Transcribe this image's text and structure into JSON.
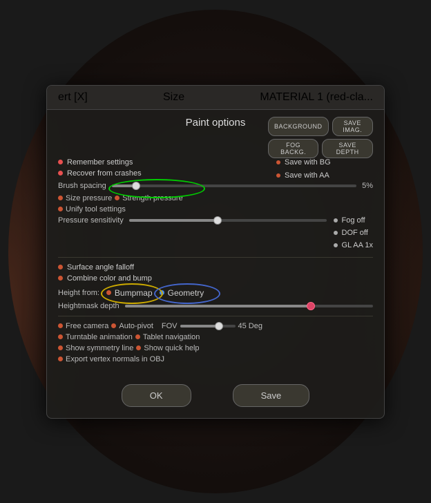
{
  "window": {
    "title_left": "ert [X]",
    "title_center": "Size",
    "title_right": "MATERIAL 1 (red-cla..."
  },
  "dialog": {
    "title": "Paint options",
    "buttons": {
      "background": "BACKGROUND",
      "save_image": "SAVE IMAG.",
      "fog_background": "FOG BACKG.",
      "save_depth": "SAVE DEPTH",
      "save_with_bg": "Save with BG",
      "save_with_aa": "Save with AA"
    },
    "options": {
      "remember_settings": "Remember settings",
      "recover_from_crashes": "Recover from crashes"
    },
    "brush_spacing": {
      "label": "Brush spacing",
      "value": "5%"
    },
    "checkboxes": {
      "size_pressure": "Size pressure",
      "strength_pressure": "Strength pressure",
      "unify_tool_settings": "Unify tool settings"
    },
    "pressure_sensitivity": "Pressure sensitivity",
    "right_options": {
      "fog_off": "Fog off",
      "dof_off": "DOF off",
      "gl_aa": "GL AA 1x"
    },
    "surface_options": {
      "surface_angle_falloff": "Surface angle falloff",
      "combine_color_and_bump": "Combine color and bump"
    },
    "height_from": {
      "label": "Height from:",
      "bumpmap": "Bumpmap",
      "geometry": "Geometry"
    },
    "heightmask_depth": "Heightmask depth",
    "bottom_options": {
      "free_camera": "Free camera",
      "auto_pivot": "Auto-pivot",
      "fov_label": "FOV",
      "fov_value": "45 Deg",
      "turntable_animation": "Turntable animation",
      "tablet_navigation": "Tablet navigation",
      "show_symmetry_line": "Show symmetry line",
      "show_quick_help": "Show quick help",
      "export_vertex_normals": "Export vertex normals in OBJ"
    },
    "action_buttons": {
      "ok": "OK",
      "save": "Save"
    }
  }
}
